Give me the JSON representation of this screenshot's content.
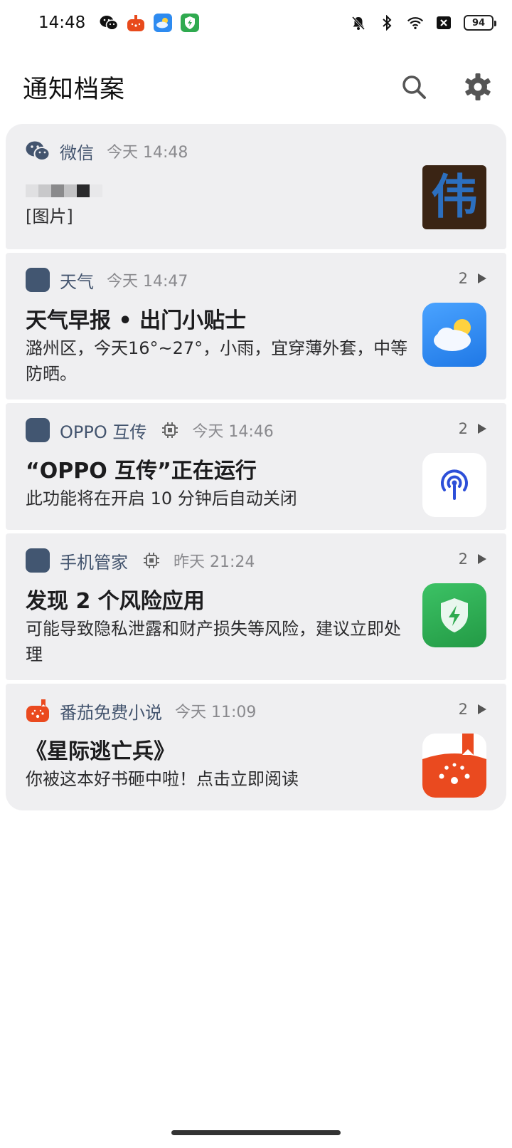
{
  "status_bar": {
    "time": "14:48",
    "battery_level": "94",
    "icons_left": [
      "wechat-icon",
      "fanqie-icon",
      "weather-icon",
      "phone-manager-icon"
    ],
    "icons_right": [
      "mute-bell-icon",
      "bluetooth-icon",
      "wifi-icon",
      "sim-off-icon",
      "battery-icon"
    ]
  },
  "header": {
    "title": "通知档案",
    "search_icon": "search-icon",
    "settings_icon": "gear-icon"
  },
  "colors": {
    "card_bg": "#efeff1",
    "app_name": "#43546e",
    "time_text": "#8a8a8e",
    "placeholder_icon": "#425671",
    "weather_blue": "#2e8bf0",
    "manager_green": "#2faa4f",
    "fanqie_red": "#ea4a1f"
  },
  "notifications": [
    {
      "app": "微信",
      "time": "今天 14:48",
      "sender_blurred": true,
      "body": "[图片]",
      "thumb_char": "伟",
      "icon": "wechat-icon"
    },
    {
      "app": "天气",
      "time": "今天 14:47",
      "count": "2",
      "title": "天气早报 • 出门小贴士",
      "body": "潞州区，今天16°~27°，小雨，宜穿薄外套，中等防晒。",
      "icon": "weather-app-icon"
    },
    {
      "app": "OPPO 互传",
      "time": "今天 14:46",
      "count": "2",
      "title": "“OPPO 互传”正在运行",
      "body": "此功能将在开启 10 分钟后自动关闭",
      "icon": "oppo-share-icon"
    },
    {
      "app": "手机管家",
      "time": "昨天 21:24",
      "count": "2",
      "title": "发现 2 个风险应用",
      "body": "可能导致隐私泄露和财产损失等风险，建议立即处理",
      "icon": "phone-manager-icon"
    },
    {
      "app": "番茄免费小说",
      "time": "今天 11:09",
      "count": "2",
      "title": "《星际逃亡兵》",
      "body": "你被这本好书砸中啦！点击立即阅读",
      "icon": "fanqie-novel-icon"
    }
  ]
}
